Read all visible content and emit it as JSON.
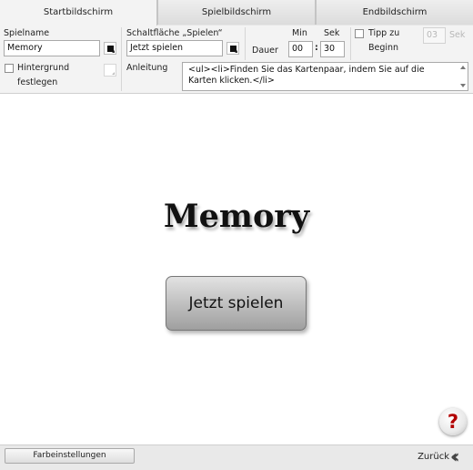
{
  "tabs": [
    {
      "label": "Startbildschirm",
      "active": true
    },
    {
      "label": "Spielbildschirm",
      "active": false
    },
    {
      "label": "Endbildschirm",
      "active": false
    }
  ],
  "settings": {
    "game_name": {
      "label": "Spielname",
      "value": "Memory"
    },
    "play_button": {
      "label": "Schaltfläche „Spielen“",
      "value": "Jetzt spielen"
    },
    "duration": {
      "label": "Dauer",
      "min_label": "Min",
      "sec_label": "Sek",
      "min_value": "00",
      "sec_value": "30",
      "separator": ":"
    },
    "tip": {
      "label_line1": "Tipp zu",
      "label_line2": "Beginn",
      "checked": false,
      "value": "03",
      "unit": "Sek"
    },
    "background": {
      "label_line1": "Hintergrund",
      "label_line2": "festlegen",
      "checked": false
    },
    "instructions": {
      "label": "Anleitung",
      "value": "<ul><li>Finden Sie das Kartenpaar, indem Sie auf die Karten klicken.</li>"
    },
    "color_swatch": "#111111"
  },
  "preview": {
    "title": "Memory",
    "play_button_label": "Jetzt spielen",
    "help_label": "?"
  },
  "footer": {
    "color_settings_label": "Farbeinstellungen",
    "back_label": "Zurück",
    "back_icon": "double-chevron-left-icon"
  },
  "colors": {
    "help_accent": "#b20000",
    "tab_active_bg": "#f3f3f3",
    "panel_bg": "#f3f3f3"
  }
}
